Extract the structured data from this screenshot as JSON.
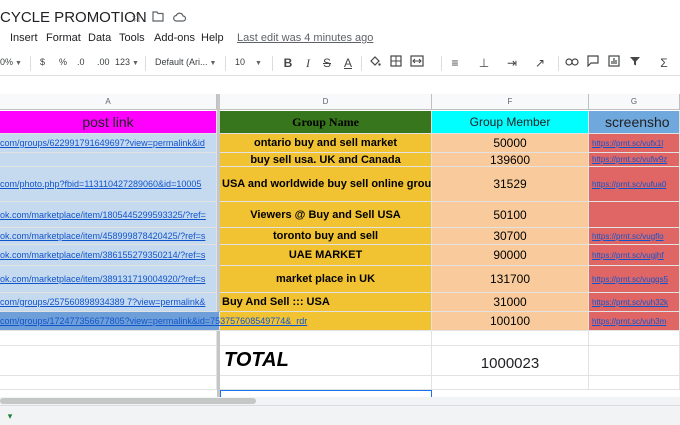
{
  "title": "CYCLE PROMOTION",
  "menu": [
    "Insert",
    "Format",
    "Data",
    "Tools",
    "Add-ons",
    "Help"
  ],
  "last_edit": "Last edit was 4 minutes ago",
  "toolbar": {
    "zoom": "0%",
    "currency": "$",
    "percent": "%",
    "dec_less": ".0",
    "dec_more": ".00",
    "number_format": "123",
    "font": "Default (Ari...",
    "font_size": "10",
    "bold": "B",
    "italic": "I",
    "strike": "S",
    "text_color": "A",
    "sum": "Σ"
  },
  "columns": {
    "a": "A",
    "d": "D",
    "f": "F",
    "g": "G"
  },
  "headers": {
    "post_link": "post link",
    "group_name": "Group  Name",
    "group_member": "Group  Member",
    "screenshot": "screensho"
  },
  "rows": [
    {
      "link": "com/groups/622991791649697?view=permalink&id",
      "group": "ontario buy and sell  market",
      "members": "50000",
      "screenshot": "https://prnt.sc/vufx1l"
    },
    {
      "link": "",
      "group": "buy sell usa.   UK and Canada",
      "members": "139600",
      "screenshot": "https://prnt.sc/vufw9z"
    },
    {
      "link": "com/photo.php?fbid=113110427289060&id=10005",
      "group": "USA and worldwide buy sell online  group",
      "members": "31529",
      "screenshot": "https://prnt.sc/vufua0"
    },
    {
      "link": "ok.com/marketplace/item/1805445299593325/?ref=",
      "group": "Viewers @ Buy and Sell USA",
      "members": "50100",
      "screenshot": ""
    },
    {
      "link": "ok.com/marketplace/item/458999878420425/?ref=s",
      "group": "toronto buy and sell",
      "members": "30700",
      "screenshot": "https://prnt.sc/vugflo"
    },
    {
      "link": "ok.com/marketplace/item/386155279350214/?ref=s",
      "group": "UAE MARKET",
      "members": "90000",
      "screenshot": "https://prnt.sc/vugjhf"
    },
    {
      "link": "ok.com/marketplace/item/389131719004920/?ref=s",
      "group": "market place in UK",
      "members": "131700",
      "screenshot": "https://prnt.sc/vugqs5"
    },
    {
      "link": "com/groups/257560898934389 7?view=permalink&",
      "group": "Buy And Sell ::: USA",
      "members": "31000",
      "screenshot": "https://prnt.sc/vuh32k"
    },
    {
      "link": "com/groups/172477356677805?view=permalink&id=753757608549774&_rdr",
      "group": "",
      "members": "100100",
      "screenshot": "https://prnt.sc/vuh3m"
    }
  ],
  "total": {
    "label": "TOTAL",
    "value": "1000023"
  },
  "colors": {
    "magenta": "#ff00ff",
    "green": "#38761d",
    "cyan": "#00ffff",
    "blue": "#6fa8dc",
    "yellow": "#f1c232",
    "orange": "#f9cb9c",
    "red": "#e06666",
    "link_bg": "#c5d9ef"
  }
}
